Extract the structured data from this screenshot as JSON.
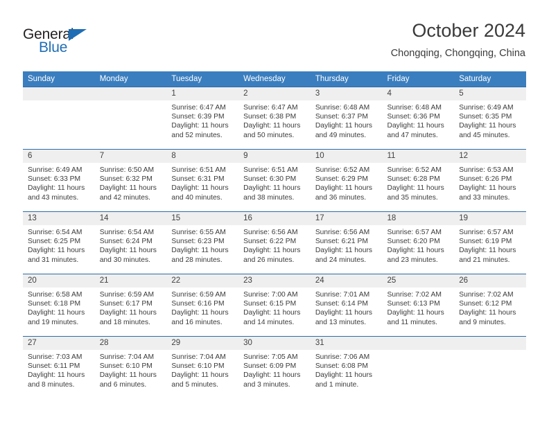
{
  "brand": {
    "name_part1": "General",
    "name_part2": "Blue",
    "accent_color": "#1f6eb5"
  },
  "header": {
    "month_title": "October 2024",
    "location": "Chongqing, Chongqing, China"
  },
  "theme": {
    "header_row_bg": "#3a7ebf",
    "daynum_bg": "#efefef",
    "week_divider": "#2d6ca8",
    "text": "#3b3b3b"
  },
  "weekday_headers": [
    "Sunday",
    "Monday",
    "Tuesday",
    "Wednesday",
    "Thursday",
    "Friday",
    "Saturday"
  ],
  "labels": {
    "sunrise_prefix": "Sunrise:",
    "sunset_prefix": "Sunset:",
    "daylight_prefix": "Daylight:"
  },
  "weeks": [
    [
      {
        "day": "",
        "sunrise": "",
        "sunset": "",
        "daylight_line1": "",
        "daylight_line2": "",
        "empty": true
      },
      {
        "day": "",
        "sunrise": "",
        "sunset": "",
        "daylight_line1": "",
        "daylight_line2": "",
        "empty": true
      },
      {
        "day": "1",
        "sunrise": "Sunrise: 6:47 AM",
        "sunset": "Sunset: 6:39 PM",
        "daylight_line1": "Daylight: 11 hours",
        "daylight_line2": "and 52 minutes."
      },
      {
        "day": "2",
        "sunrise": "Sunrise: 6:47 AM",
        "sunset": "Sunset: 6:38 PM",
        "daylight_line1": "Daylight: 11 hours",
        "daylight_line2": "and 50 minutes."
      },
      {
        "day": "3",
        "sunrise": "Sunrise: 6:48 AM",
        "sunset": "Sunset: 6:37 PM",
        "daylight_line1": "Daylight: 11 hours",
        "daylight_line2": "and 49 minutes."
      },
      {
        "day": "4",
        "sunrise": "Sunrise: 6:48 AM",
        "sunset": "Sunset: 6:36 PM",
        "daylight_line1": "Daylight: 11 hours",
        "daylight_line2": "and 47 minutes."
      },
      {
        "day": "5",
        "sunrise": "Sunrise: 6:49 AM",
        "sunset": "Sunset: 6:35 PM",
        "daylight_line1": "Daylight: 11 hours",
        "daylight_line2": "and 45 minutes."
      }
    ],
    [
      {
        "day": "6",
        "sunrise": "Sunrise: 6:49 AM",
        "sunset": "Sunset: 6:33 PM",
        "daylight_line1": "Daylight: 11 hours",
        "daylight_line2": "and 43 minutes."
      },
      {
        "day": "7",
        "sunrise": "Sunrise: 6:50 AM",
        "sunset": "Sunset: 6:32 PM",
        "daylight_line1": "Daylight: 11 hours",
        "daylight_line2": "and 42 minutes."
      },
      {
        "day": "8",
        "sunrise": "Sunrise: 6:51 AM",
        "sunset": "Sunset: 6:31 PM",
        "daylight_line1": "Daylight: 11 hours",
        "daylight_line2": "and 40 minutes."
      },
      {
        "day": "9",
        "sunrise": "Sunrise: 6:51 AM",
        "sunset": "Sunset: 6:30 PM",
        "daylight_line1": "Daylight: 11 hours",
        "daylight_line2": "and 38 minutes."
      },
      {
        "day": "10",
        "sunrise": "Sunrise: 6:52 AM",
        "sunset": "Sunset: 6:29 PM",
        "daylight_line1": "Daylight: 11 hours",
        "daylight_line2": "and 36 minutes."
      },
      {
        "day": "11",
        "sunrise": "Sunrise: 6:52 AM",
        "sunset": "Sunset: 6:28 PM",
        "daylight_line1": "Daylight: 11 hours",
        "daylight_line2": "and 35 minutes."
      },
      {
        "day": "12",
        "sunrise": "Sunrise: 6:53 AM",
        "sunset": "Sunset: 6:26 PM",
        "daylight_line1": "Daylight: 11 hours",
        "daylight_line2": "and 33 minutes."
      }
    ],
    [
      {
        "day": "13",
        "sunrise": "Sunrise: 6:54 AM",
        "sunset": "Sunset: 6:25 PM",
        "daylight_line1": "Daylight: 11 hours",
        "daylight_line2": "and 31 minutes."
      },
      {
        "day": "14",
        "sunrise": "Sunrise: 6:54 AM",
        "sunset": "Sunset: 6:24 PM",
        "daylight_line1": "Daylight: 11 hours",
        "daylight_line2": "and 30 minutes."
      },
      {
        "day": "15",
        "sunrise": "Sunrise: 6:55 AM",
        "sunset": "Sunset: 6:23 PM",
        "daylight_line1": "Daylight: 11 hours",
        "daylight_line2": "and 28 minutes."
      },
      {
        "day": "16",
        "sunrise": "Sunrise: 6:56 AM",
        "sunset": "Sunset: 6:22 PM",
        "daylight_line1": "Daylight: 11 hours",
        "daylight_line2": "and 26 minutes."
      },
      {
        "day": "17",
        "sunrise": "Sunrise: 6:56 AM",
        "sunset": "Sunset: 6:21 PM",
        "daylight_line1": "Daylight: 11 hours",
        "daylight_line2": "and 24 minutes."
      },
      {
        "day": "18",
        "sunrise": "Sunrise: 6:57 AM",
        "sunset": "Sunset: 6:20 PM",
        "daylight_line1": "Daylight: 11 hours",
        "daylight_line2": "and 23 minutes."
      },
      {
        "day": "19",
        "sunrise": "Sunrise: 6:57 AM",
        "sunset": "Sunset: 6:19 PM",
        "daylight_line1": "Daylight: 11 hours",
        "daylight_line2": "and 21 minutes."
      }
    ],
    [
      {
        "day": "20",
        "sunrise": "Sunrise: 6:58 AM",
        "sunset": "Sunset: 6:18 PM",
        "daylight_line1": "Daylight: 11 hours",
        "daylight_line2": "and 19 minutes."
      },
      {
        "day": "21",
        "sunrise": "Sunrise: 6:59 AM",
        "sunset": "Sunset: 6:17 PM",
        "daylight_line1": "Daylight: 11 hours",
        "daylight_line2": "and 18 minutes."
      },
      {
        "day": "22",
        "sunrise": "Sunrise: 6:59 AM",
        "sunset": "Sunset: 6:16 PM",
        "daylight_line1": "Daylight: 11 hours",
        "daylight_line2": "and 16 minutes."
      },
      {
        "day": "23",
        "sunrise": "Sunrise: 7:00 AM",
        "sunset": "Sunset: 6:15 PM",
        "daylight_line1": "Daylight: 11 hours",
        "daylight_line2": "and 14 minutes."
      },
      {
        "day": "24",
        "sunrise": "Sunrise: 7:01 AM",
        "sunset": "Sunset: 6:14 PM",
        "daylight_line1": "Daylight: 11 hours",
        "daylight_line2": "and 13 minutes."
      },
      {
        "day": "25",
        "sunrise": "Sunrise: 7:02 AM",
        "sunset": "Sunset: 6:13 PM",
        "daylight_line1": "Daylight: 11 hours",
        "daylight_line2": "and 11 minutes."
      },
      {
        "day": "26",
        "sunrise": "Sunrise: 7:02 AM",
        "sunset": "Sunset: 6:12 PM",
        "daylight_line1": "Daylight: 11 hours",
        "daylight_line2": "and 9 minutes."
      }
    ],
    [
      {
        "day": "27",
        "sunrise": "Sunrise: 7:03 AM",
        "sunset": "Sunset: 6:11 PM",
        "daylight_line1": "Daylight: 11 hours",
        "daylight_line2": "and 8 minutes."
      },
      {
        "day": "28",
        "sunrise": "Sunrise: 7:04 AM",
        "sunset": "Sunset: 6:10 PM",
        "daylight_line1": "Daylight: 11 hours",
        "daylight_line2": "and 6 minutes."
      },
      {
        "day": "29",
        "sunrise": "Sunrise: 7:04 AM",
        "sunset": "Sunset: 6:10 PM",
        "daylight_line1": "Daylight: 11 hours",
        "daylight_line2": "and 5 minutes."
      },
      {
        "day": "30",
        "sunrise": "Sunrise: 7:05 AM",
        "sunset": "Sunset: 6:09 PM",
        "daylight_line1": "Daylight: 11 hours",
        "daylight_line2": "and 3 minutes."
      },
      {
        "day": "31",
        "sunrise": "Sunrise: 7:06 AM",
        "sunset": "Sunset: 6:08 PM",
        "daylight_line1": "Daylight: 11 hours",
        "daylight_line2": "and 1 minute."
      },
      {
        "day": "",
        "sunrise": "",
        "sunset": "",
        "daylight_line1": "",
        "daylight_line2": "",
        "empty": true
      },
      {
        "day": "",
        "sunrise": "",
        "sunset": "",
        "daylight_line1": "",
        "daylight_line2": "",
        "empty": true
      }
    ]
  ]
}
